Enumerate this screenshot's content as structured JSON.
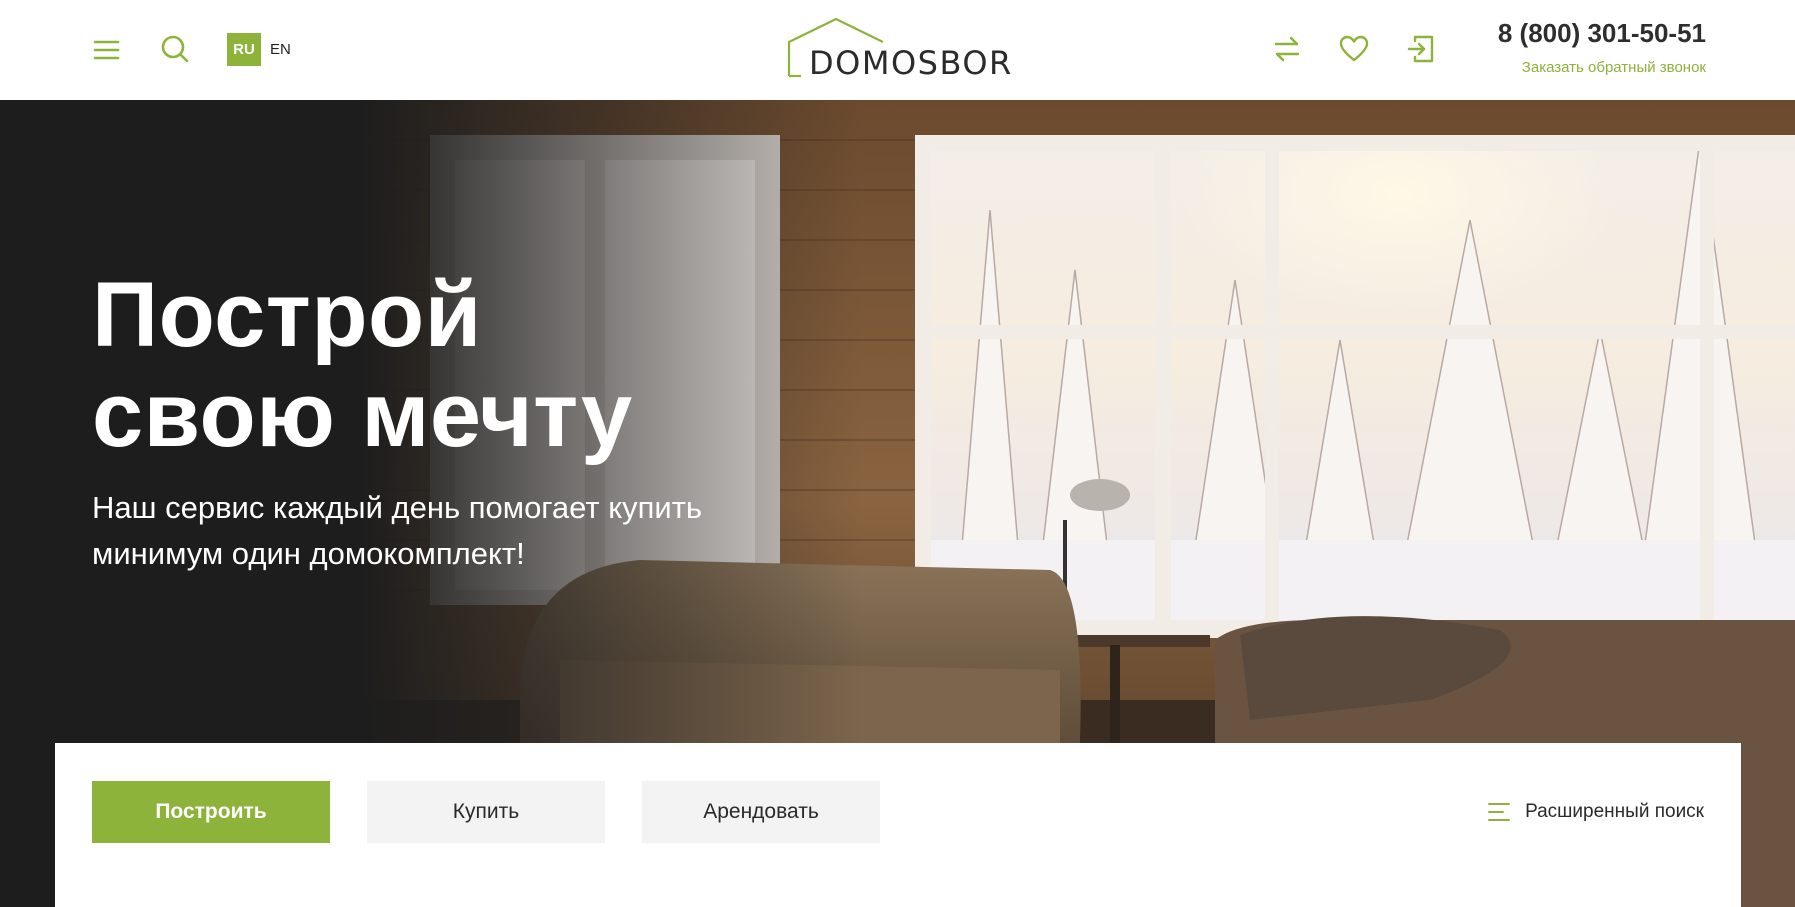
{
  "header": {
    "menu_icon": "burger-menu-icon",
    "search_icon": "search-icon",
    "languages": {
      "active": "RU",
      "other": "EN"
    },
    "logo_text": "DOMOSBOR",
    "compare_icon": "compare-arrows-icon",
    "favorites_icon": "heart-icon",
    "login_icon": "login-icon",
    "phone": "8 (800) 301-50-51",
    "callback_link": "Заказать обратный звонок"
  },
  "hero": {
    "title_line1": "Построй",
    "title_line2": "свою мечту",
    "subtitle": "Наш сервис каждый день помогает купить минимум один домокомплект!"
  },
  "search_panel": {
    "tabs": [
      {
        "label": "Построить",
        "active": true
      },
      {
        "label": "Купить",
        "active": false
      },
      {
        "label": "Арендовать",
        "active": false
      }
    ],
    "advanced_search_label": "Расширенный поиск",
    "advanced_search_icon": "filter-lines-icon"
  },
  "colors": {
    "accent": "#8db33a",
    "text_dark": "#2e2e2e",
    "hero_dark": "#1d1d1d",
    "tab_inactive": "#f3f3f3"
  }
}
